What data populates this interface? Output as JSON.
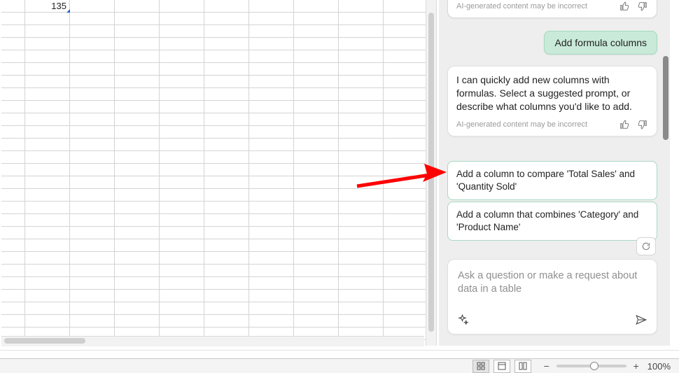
{
  "spreadsheet": {
    "visible_values": {
      "row1_colB": "135"
    }
  },
  "panel": {
    "partial_card": {
      "disclaimer": "AI-generated content may be incorrect"
    },
    "user_message": "Add formula columns",
    "bot_response": {
      "text": "I can quickly add new columns with formulas. Select a suggested prompt, or describe what columns you'd like to add.",
      "disclaimer": "AI-generated content may be incorrect"
    },
    "suggestions": [
      "Add a column to compare 'Total Sales' and 'Quantity Sold'",
      "Add a column that combines 'Category' and 'Product Name'"
    ],
    "input": {
      "placeholder": "Ask a question or make a request about data in a table"
    }
  },
  "statusbar": {
    "zoom_label": "100%",
    "zoom_minus": "−",
    "zoom_plus": "+"
  }
}
